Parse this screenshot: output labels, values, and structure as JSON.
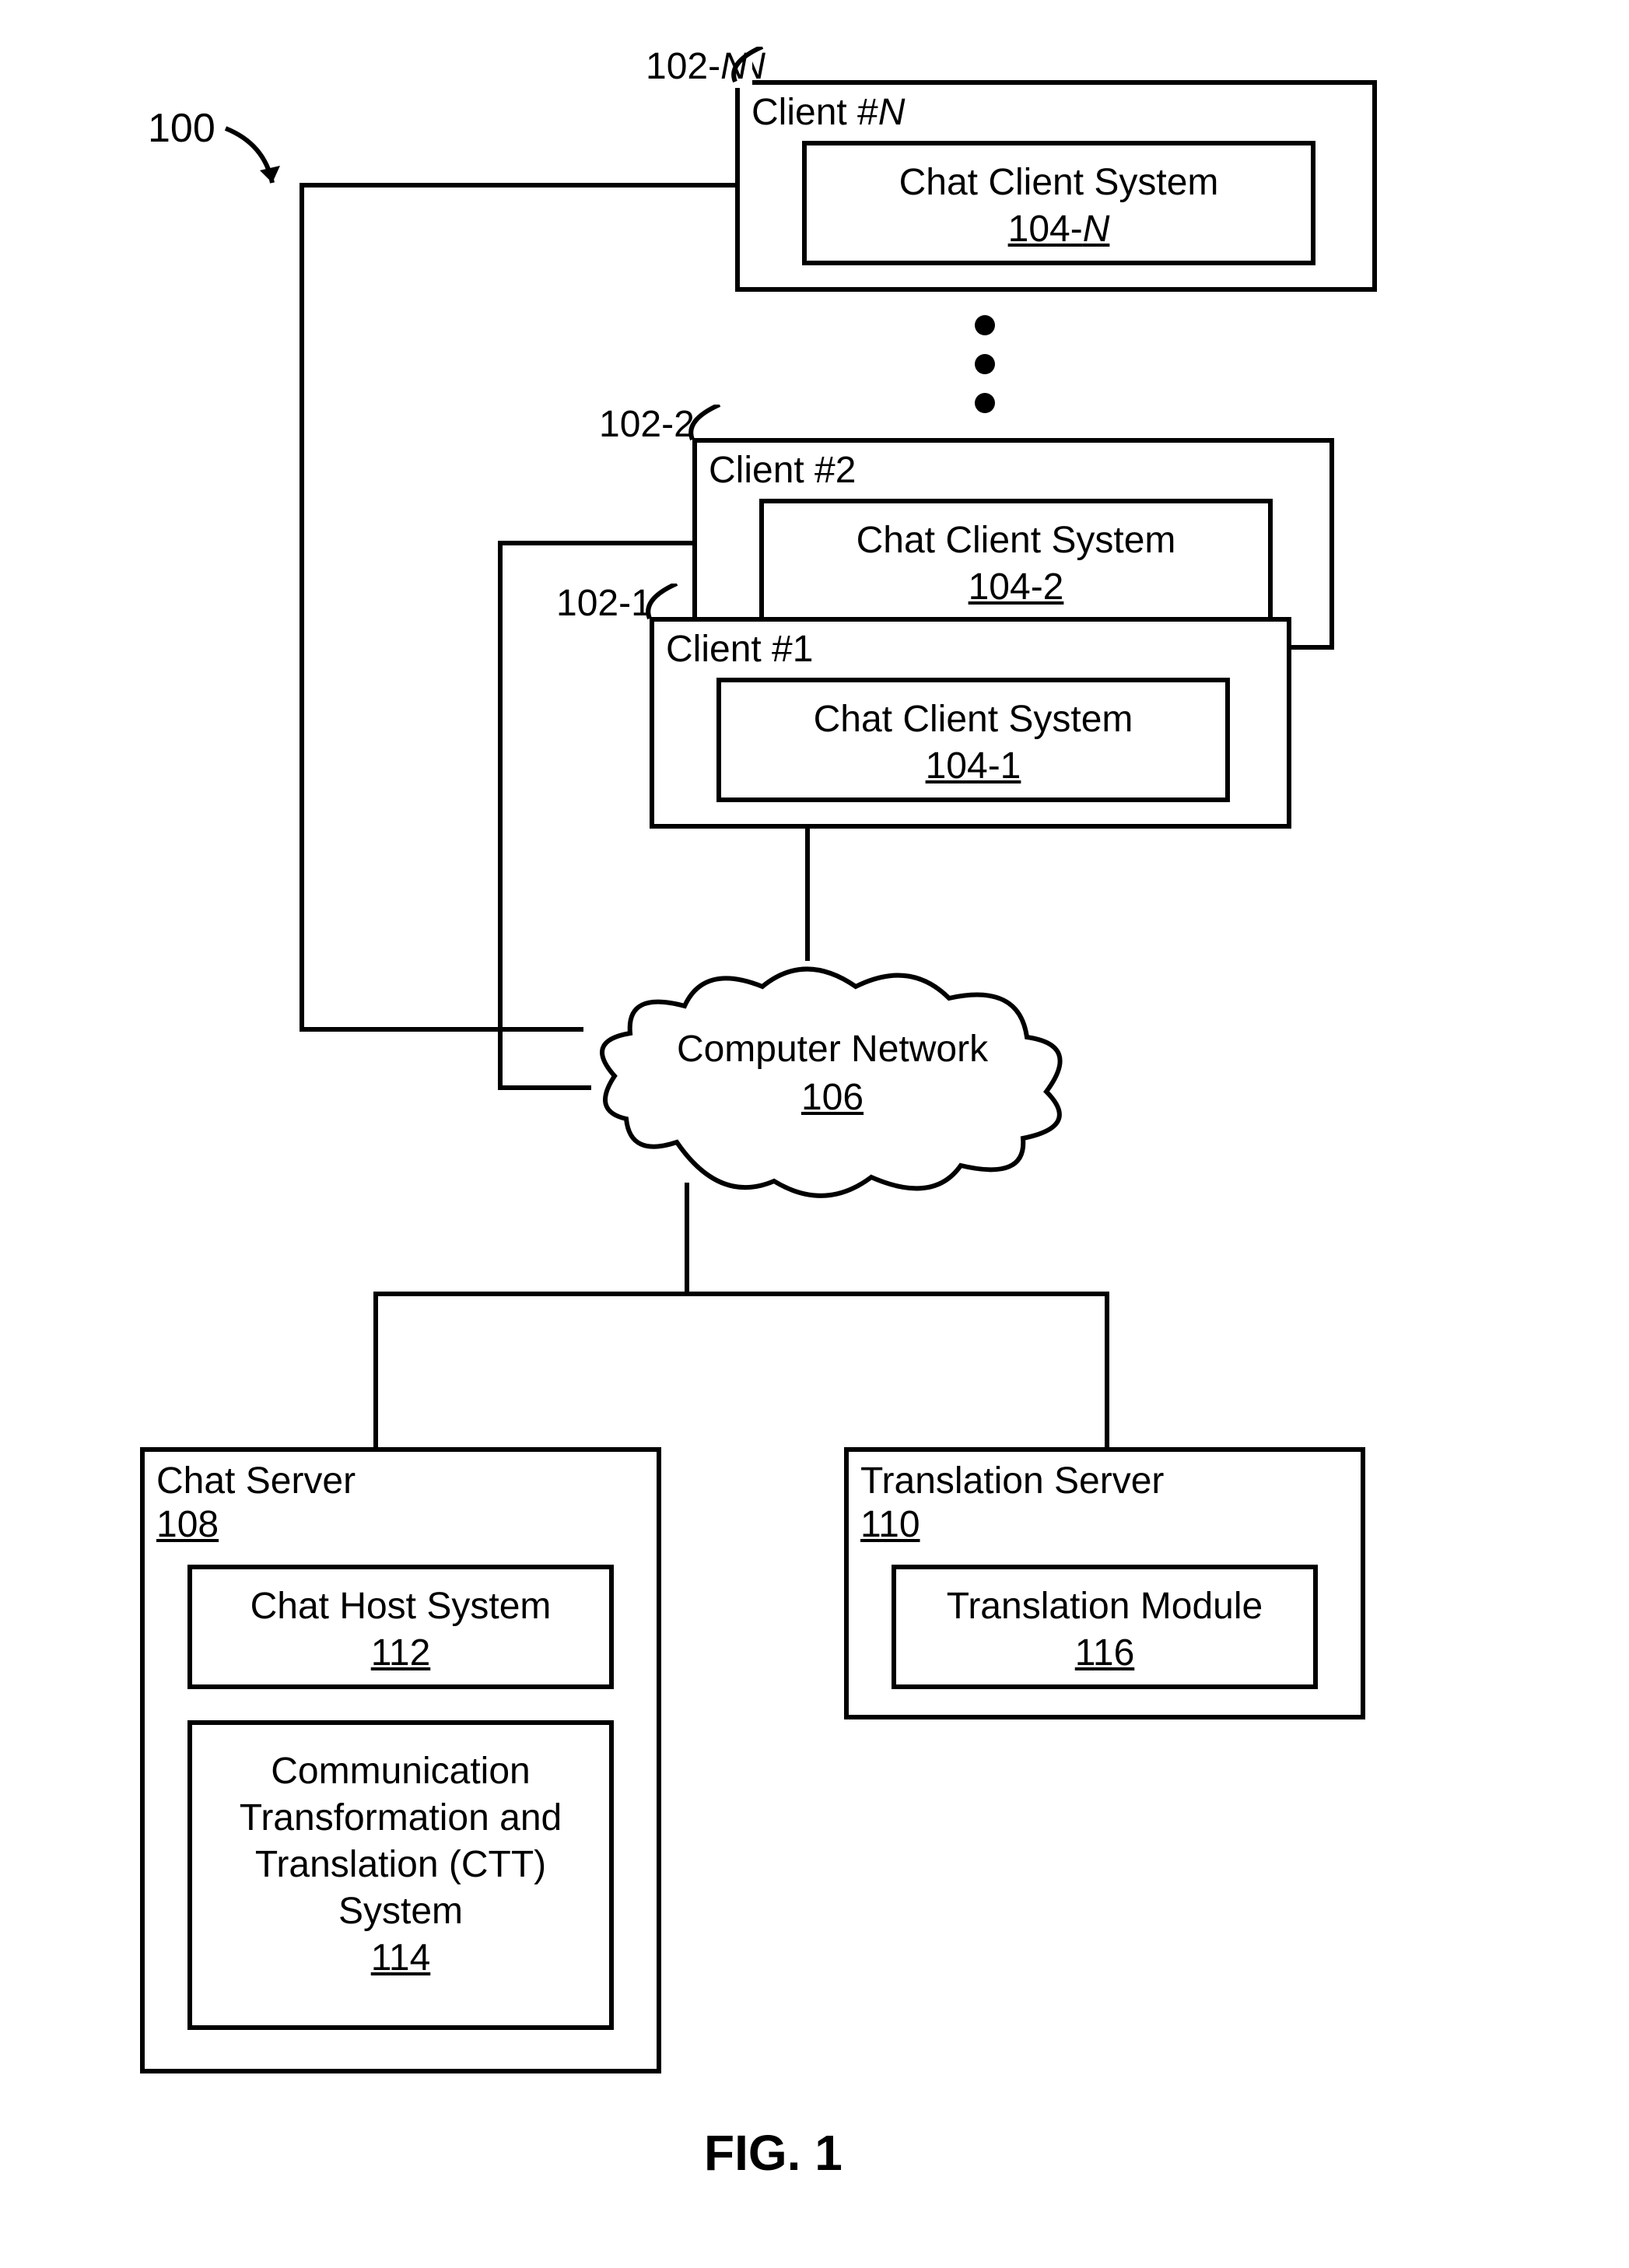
{
  "figure_ref": "100",
  "figure_caption": "FIG. 1",
  "clients": {
    "n": {
      "ref": "102-N",
      "title_prefix": "Client #",
      "title_suffix": "N",
      "inner": {
        "label": "Chat Client System",
        "ref_prefix": "104-",
        "ref_suffix": "N"
      }
    },
    "c2": {
      "ref": "102-2",
      "title": "Client #2",
      "inner": {
        "label": "Chat Client System",
        "ref": "104-2"
      }
    },
    "c1": {
      "ref": "102-1",
      "title": "Client #1",
      "inner": {
        "label": "Chat Client System",
        "ref": "104-1"
      }
    }
  },
  "network": {
    "label": "Computer Network",
    "ref": "106"
  },
  "chat_server": {
    "title": "Chat Server",
    "ref": "108",
    "host": {
      "label": "Chat Host System",
      "ref": "112"
    },
    "ctt": {
      "lines": [
        "Communication",
        "Transformation and",
        "Translation (CTT)",
        "System"
      ],
      "ref": "114"
    }
  },
  "translation_server": {
    "title": "Translation Server",
    "ref": "110",
    "module": {
      "label": "Translation Module",
      "ref": "116"
    }
  }
}
